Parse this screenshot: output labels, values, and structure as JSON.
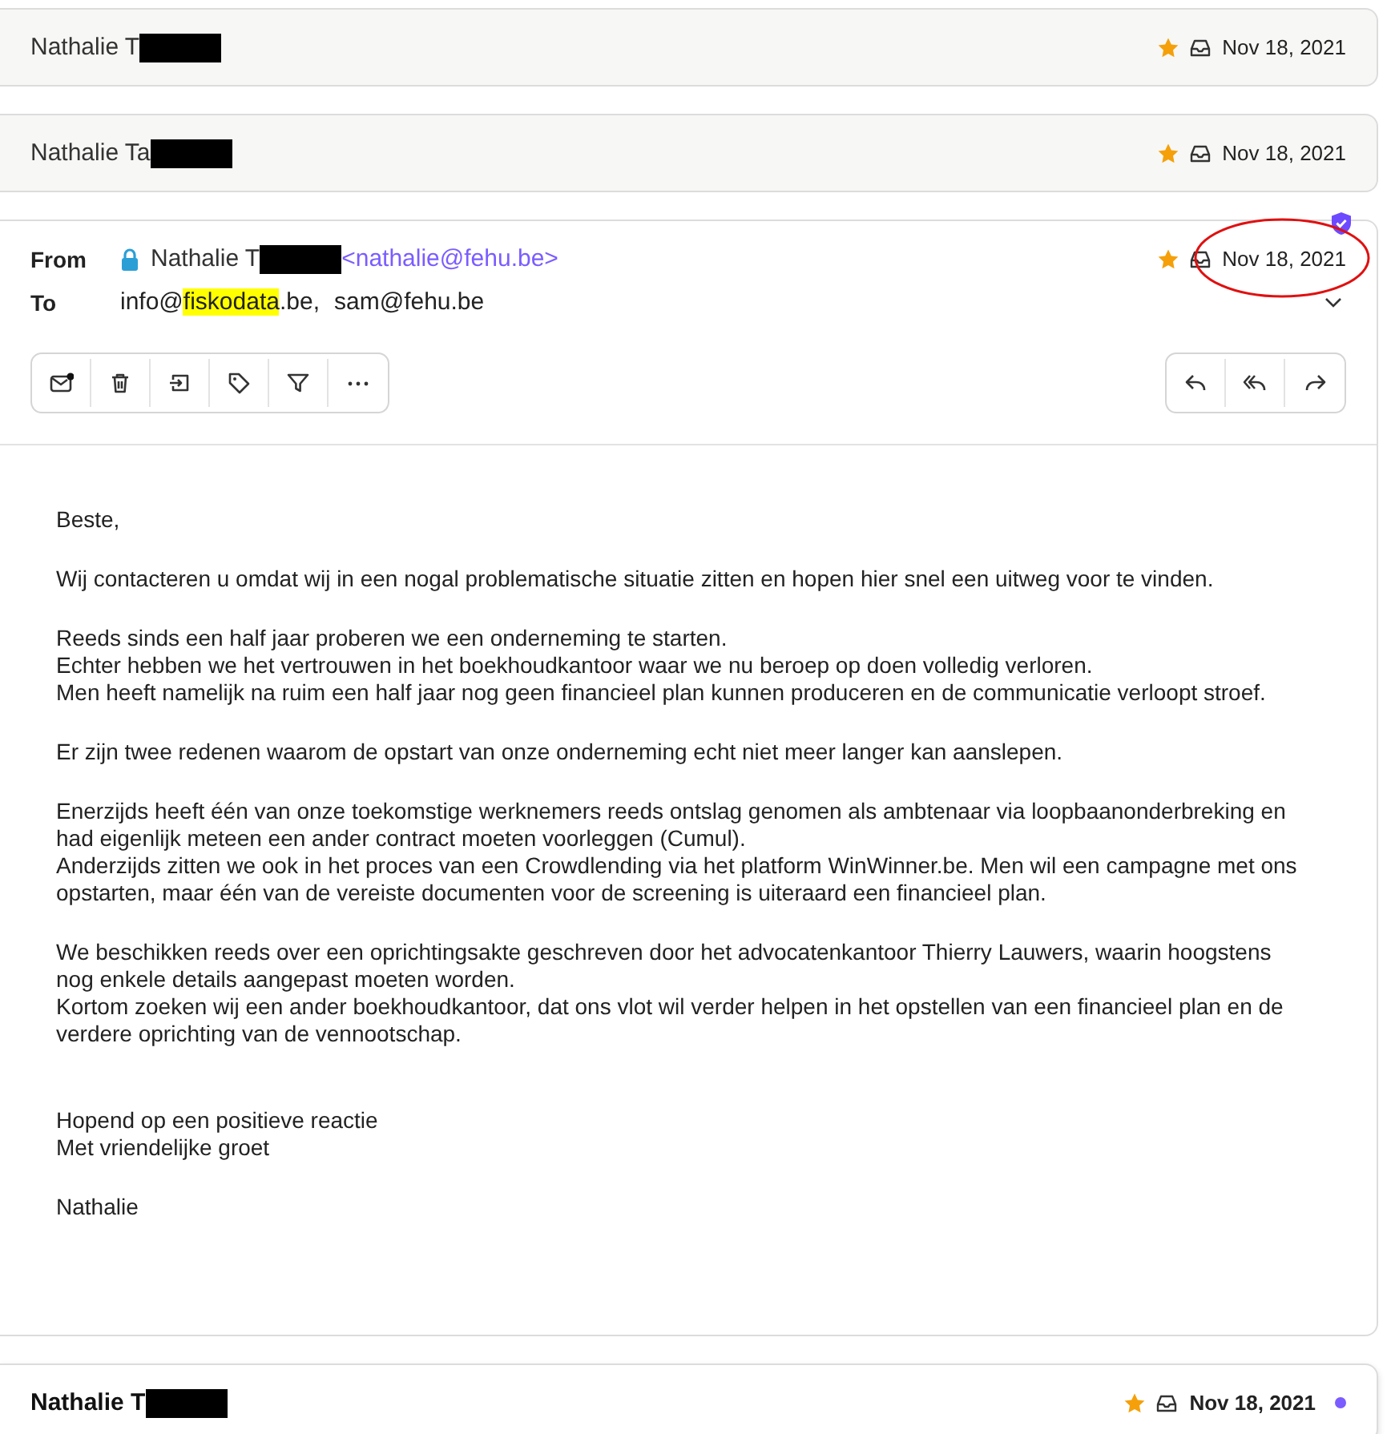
{
  "messages": [
    {
      "kind": "collapsed",
      "sender": "Nathalie T",
      "redacted": true,
      "starred": true,
      "date": "Nov 18, 2021",
      "unread": false
    },
    {
      "kind": "collapsed",
      "sender": "Nathalie Ta",
      "redacted": true,
      "starred": true,
      "date": "Nov 18, 2021",
      "unread": false
    },
    {
      "kind": "expanded",
      "verified": true,
      "from_label": "From",
      "to_label": "To",
      "sender": "Nathalie T",
      "redacted": true,
      "address": "<nathalie@fehu.be>",
      "starred": true,
      "date": "Nov 18, 2021",
      "date_circled": true,
      "recipients": [
        {
          "before": "info@",
          "highlight": "fiskodata",
          "after": ".be,"
        },
        {
          "before": "sam@fehu.be"
        }
      ],
      "paragraphs": [
        [
          "Beste,"
        ],
        [
          "Wij contacteren u omdat wij in een nogal problematische situatie zitten en hopen hier snel een uitweg voor te vinden."
        ],
        [
          "Reeds sinds een half jaar proberen we een onderneming te starten.",
          "Echter hebben we het vertrouwen in het boekhoudkantoor waar we nu beroep op doen volledig verloren.",
          "Men heeft namelijk na ruim een half jaar nog geen financieel plan kunnen produceren en de communicatie verloopt stroef."
        ],
        [
          "Er zijn twee redenen waarom de opstart van onze onderneming echt niet meer langer kan aanslepen."
        ],
        [
          "Enerzijds heeft één van onze toekomstige werknemers reeds ontslag genomen als ambtenaar via loopbaanonderbreking en had eigenlijk meteen een ander contract moeten voorleggen (Cumul).",
          "Anderzijds zitten we ook in het proces van een Crowdlending via het platform WinWinner.be. Men wil een campagne met ons opstarten, maar één van de vereiste documenten voor de screening is uiteraard een financieel plan."
        ],
        [
          "We beschikken reeds over een oprichtingsakte geschreven door het advocatenkantoor Thierry Lauwers, waarin hoogstens nog enkele details aangepast moeten worden.",
          "Kortom zoeken wij een ander boekhoudkantoor, dat ons vlot wil verder helpen in het opstellen van een financieel plan en de verdere oprichting van de vennootschap."
        ],
        [
          "Hopend op een positieve reactie",
          "Met vriendelijke groet"
        ],
        [
          "Nathalie"
        ]
      ]
    },
    {
      "kind": "collapsed",
      "sender": "Nathalie T",
      "redacted": true,
      "starred": true,
      "date": "Nov 18, 2021",
      "unread": true
    }
  ]
}
